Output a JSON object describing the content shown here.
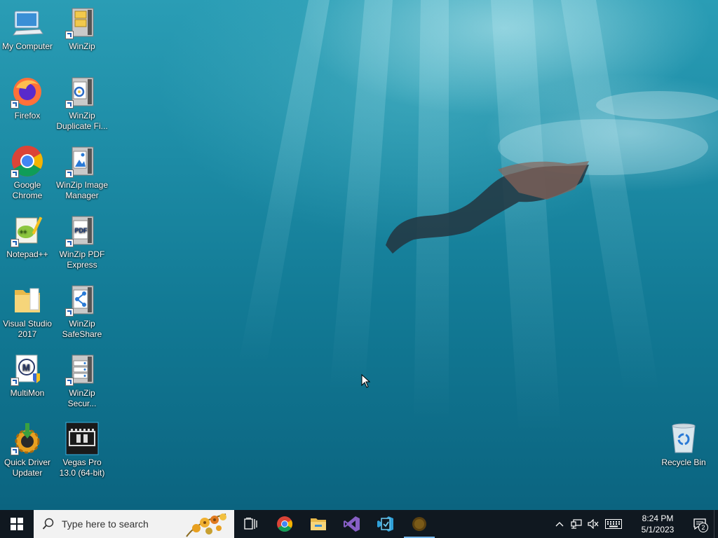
{
  "desktop": {
    "icons": [
      {
        "name": "my-computer",
        "label": "My Computer"
      },
      {
        "name": "winzip",
        "label": "WinZip"
      },
      {
        "name": "firefox",
        "label": "Firefox"
      },
      {
        "name": "winzip-duplicate",
        "label": "WinZip Duplicate Fi..."
      },
      {
        "name": "google-chrome",
        "label": "Google Chrome"
      },
      {
        "name": "winzip-image-manager",
        "label": "WinZip Image Manager"
      },
      {
        "name": "notepad-plus-plus",
        "label": "Notepad++"
      },
      {
        "name": "winzip-pdf-express",
        "label": "WinZip PDF Express"
      },
      {
        "name": "visual-studio-2017",
        "label": "Visual Studio 2017"
      },
      {
        "name": "winzip-safeshare",
        "label": "WinZip SafeShare"
      },
      {
        "name": "multimon",
        "label": "MultiMon"
      },
      {
        "name": "winzip-secure",
        "label": "WinZip Secur..."
      },
      {
        "name": "quick-driver-updater",
        "label": "Quick Driver Updater"
      },
      {
        "name": "vegas-pro",
        "label": "Vegas Pro 13.0 (64-bit)"
      },
      {
        "name": "recycle-bin",
        "label": "Recycle Bin"
      }
    ]
  },
  "taskbar": {
    "search_placeholder": "Type here to search",
    "pinned": [
      "task-view-icon",
      "chrome-icon",
      "file-explorer-icon",
      "visual-studio-icon",
      "vs-installer-icon",
      "running-app-icon"
    ],
    "clock": {
      "time": "8:24 PM",
      "date": "5/1/2023"
    },
    "notification_count": "2"
  },
  "colors": {
    "taskbar": "#101820",
    "accent": "#76b9ed"
  }
}
